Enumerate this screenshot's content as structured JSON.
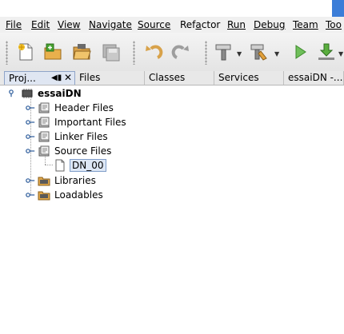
{
  "menu": [
    {
      "label": "File",
      "mnemonic_index": 0
    },
    {
      "label": "Edit",
      "mnemonic_index": 0
    },
    {
      "label": "View",
      "mnemonic_index": 0
    },
    {
      "label": "Navigate",
      "mnemonic_index": 0
    },
    {
      "label": "Source",
      "mnemonic_index": 0
    },
    {
      "label": "Refactor",
      "mnemonic_index": 3
    },
    {
      "label": "Run",
      "mnemonic_index": 0
    },
    {
      "label": "Debug",
      "mnemonic_index": 0
    },
    {
      "label": "Team",
      "mnemonic_index": 0
    },
    {
      "label": "Tools",
      "mnemonic_index": 0
    }
  ],
  "menu_visible": [
    "File",
    "Edit",
    "View",
    "Navigate",
    "Source",
    "Refactor",
    "Run",
    "Debug",
    "Team",
    "Too"
  ],
  "toolbar": {
    "icons": [
      "new-file-icon",
      "new-project-icon",
      "open-project-icon",
      "save-all-icon",
      "undo-icon",
      "redo-icon",
      "build-icon",
      "clean-build-icon",
      "run-icon",
      "debug-icon"
    ]
  },
  "tabs": {
    "projects": "Proj...",
    "files": "Files",
    "classes": "Classes",
    "services": "Services",
    "essai": "essaiDN -..."
  },
  "tree": {
    "root": "essaiDN",
    "children": [
      {
        "label": "Header Files",
        "icon": "folder-icon"
      },
      {
        "label": "Important Files",
        "icon": "folder-icon"
      },
      {
        "label": "Linker Files",
        "icon": "folder-icon"
      },
      {
        "label": "Source Files",
        "icon": "folder-icon"
      },
      {
        "label": "DN_00",
        "icon": "file-icon"
      },
      {
        "label": "Libraries",
        "icon": "library-folder-icon"
      },
      {
        "label": "Loadables",
        "icon": "library-folder-icon"
      }
    ]
  }
}
